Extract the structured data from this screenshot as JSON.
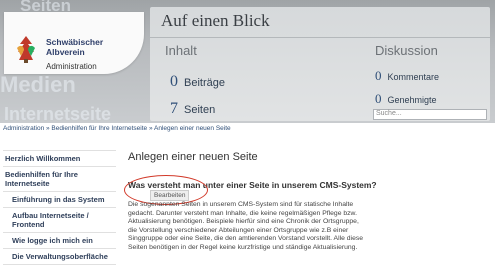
{
  "background_words": [
    "Seiten",
    "Medien",
    "Internetseite"
  ],
  "logo": {
    "name_line1": "Schwäbischer",
    "name_line2": "Albverein",
    "subtitle": "Administration"
  },
  "dashboard": {
    "title": "Auf einen Blick",
    "left_heading": "Inhalt",
    "right_heading": "Diskussion",
    "stats": [
      {
        "num": "0",
        "label": "Beiträge"
      },
      {
        "num": "7",
        "label": "Seiten"
      },
      {
        "num": "0",
        "label": "Kommentare"
      },
      {
        "num": "0",
        "label": "Genehmigte"
      }
    ],
    "search_placeholder": "Suche..."
  },
  "breadcrumb": "Administration » Bedienhilfen für Ihre Internetseite » Anlegen einer neuen Seite",
  "sidebar": {
    "items": [
      {
        "label": "Herzlich Willkommen",
        "sub": false
      },
      {
        "label": "Bedienhilfen für Ihre Internetseite",
        "sub": false
      },
      {
        "label": "Einführung in das System",
        "sub": true
      },
      {
        "label": "Aufbau Internetseite / Frontend",
        "sub": true
      },
      {
        "label": "Wie logge ich mich ein",
        "sub": true
      },
      {
        "label": "Die Verwaltungsoberfläche",
        "sub": true
      }
    ]
  },
  "main": {
    "title": "Anlegen einer neuen Seite",
    "question": "Was versteht man unter einer Seite in unserem CMS-System?",
    "edit_label": "Bearbeiten",
    "body": "Die sogenannten Seiten in unserem CMS-System sind für statische Inhalte gedacht. Darunter versteht man Inhalte, die keine regelmäßigen Pflege bzw. Aktualisierung benötigen. Beispiele hierfür sind eine Chronik der Ortsgruppe, die Vorstellung verschiedener Abteilungen einer Ortsgruppe wie z.B einer Singgruppe oder eine Seite, die den amtierenden Vorstand vorstellt. Alle diese Seiten benötigen in der Regel keine kurzfristige und ständige Aktualisierung."
  },
  "colors": {
    "accent_red": "#d23a2a",
    "link_blue": "#2f4f78"
  }
}
